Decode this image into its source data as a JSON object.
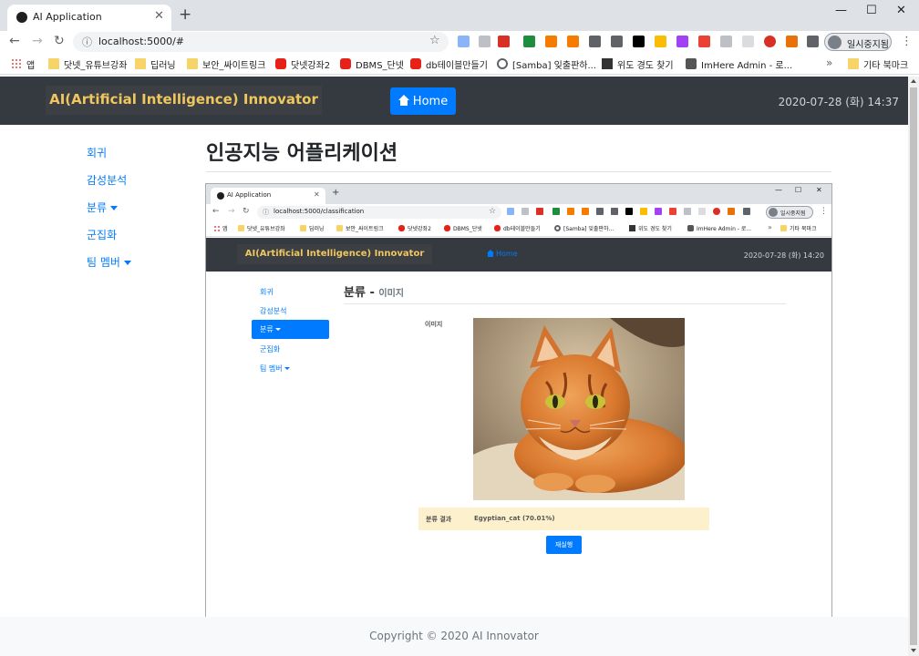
{
  "browser": {
    "tab_title": "AI Application",
    "url": "localhost:5000/#",
    "profile_name": "일시중지됨",
    "window_controls": {
      "minimize": "—",
      "maximize": "☐",
      "close": "✕"
    },
    "bookmarks": [
      "앱",
      "닷넷_유튜브강좌",
      "딥러닝",
      "보안_싸이트링크",
      "닷넷강좌2",
      "DBMS_단넷",
      "db테이블만들기",
      "[Samba] 잊출판하...",
      "위도 경도 찾기",
      "ImHere Admin - 로...",
      "기타 북마크"
    ],
    "bookmark_overflow": "»"
  },
  "navbar": {
    "brand": "AI(Artificial Intelligence) Innovator",
    "home_label": "Home",
    "datetime": "2020-07-28 (화) 14:37"
  },
  "sidebar": {
    "items": [
      {
        "label": "회귀"
      },
      {
        "label": "감성분석"
      },
      {
        "label": "분류",
        "dropdown": true
      },
      {
        "label": "군집화"
      },
      {
        "label": "팀 멤버",
        "dropdown": true
      }
    ]
  },
  "main": {
    "title": "인공지능 어플리케이션"
  },
  "screenshot": {
    "tab_title": "AI Application",
    "url": "localhost:5000/classification",
    "profile_name": "일시중지됨",
    "bookmarks": [
      "앱",
      "닷넷_유튜브강좌",
      "딥러닝",
      "보안_싸이트링크",
      "닷넷강좌2",
      "DBMS_단넷",
      "db테이블만들기",
      "[Samba] 잊출판하...",
      "위도 경도 찾기",
      "ImHere Admin - 로...",
      "기타 북마크"
    ],
    "brand": "AI(Artificial Intelligence) Innovator",
    "home_label": "Home",
    "datetime": "2020-07-28 (화) 14:20",
    "sidebar": [
      "회귀",
      "감성분석",
      "분류",
      "군집화",
      "팀 멤버"
    ],
    "page_title": "분류",
    "page_title_sep": " - ",
    "page_subtitle": "이미지",
    "image_label": "이미지",
    "result_label": "분류 결과",
    "result_value": "Egyptian_cat (70.01%)",
    "rerun_label": "재실행"
  },
  "footer": {
    "text": "Copyright © 2020 AI Innovator"
  },
  "colors": {
    "navbar_bg": "#343a40",
    "brand_text": "#f0c75e",
    "primary": "#007bff",
    "result_bg": "#fcf0cd",
    "footer_bg": "#f8f9fa"
  }
}
